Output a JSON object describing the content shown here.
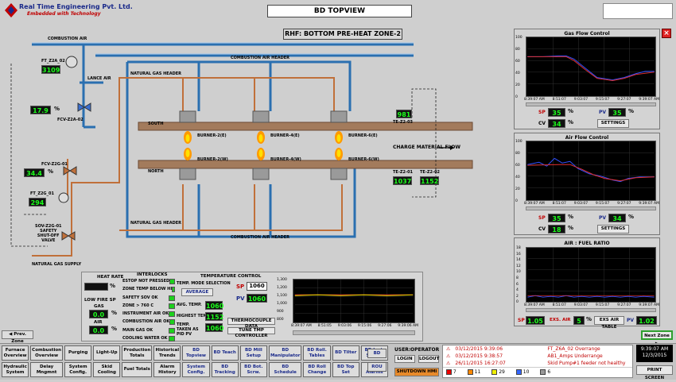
{
  "header": {
    "company_name": "Real Time Engineering Pvt. Ltd.",
    "company_tagline": "Embedded with Technology",
    "title": "BD TOPVIEW"
  },
  "schematic": {
    "zone_title": "RHF: BOTTOM PRE-HEAT ZONE-2",
    "labels": {
      "combustion_air": "COMBUSTION AIR",
      "combustion_air_header": "COMBUSTION AIR HEADER",
      "natural_gas_header": "NATURAL GAS HEADER",
      "lance_air": "LANCE AIR",
      "south": "SOUTH",
      "north": "NORTH",
      "burner_2e": "BURNER-2(E)",
      "burner_4e": "BURNER-4(E)",
      "burner_6e": "BURNER-6(E)",
      "burner_2w": "BURNER-2(W)",
      "burner_4w": "BURNER-4(W)",
      "burner_6w": "BURNER-6(W)",
      "charge_flow": "CHARGE MATERIAL  FLOW",
      "natural_gas_supply": "NATURAL GAS SUPPLY",
      "sov": "SOV-Z2G-01",
      "sov_safety": "SAFETY",
      "sov_shutoff": "SHUT-OFF",
      "sov_valve": "VALVE",
      "ft_z2a": "FT_Z2A_02",
      "fcv_z2a": "FCV-Z2A-02",
      "fcv_z2g": "FCV-Z2G-01",
      "ft_z2g": "FT_Z2G_01",
      "te_z2_03": "TE-Z2-03",
      "te_z2_01": "TE-Z2-01",
      "te_z2_02": "TE-Z2-02"
    },
    "values": {
      "ft_z2a": "3109",
      "fcv_z2a_pct": "17.9",
      "fcv_z2g_pct": "34.4",
      "ft_z2g": "294",
      "te_z2_03": "981",
      "te_z2_01": "1037",
      "te_z2_02": "1152"
    },
    "pct_sign": "%"
  },
  "gas_flow": {
    "title": "Gas Flow Control",
    "y_ticks": [
      "100",
      "80",
      "60",
      "40",
      "20",
      "0"
    ],
    "x_ticks": [
      "8:39:07 AM",
      "8:51:07",
      "9:03:07",
      "9:15:07",
      "9:27:07",
      "9:39:07 AM"
    ],
    "sp_label": "SP",
    "sp": "35",
    "pv_label": "PV",
    "pv": "35",
    "cv_label": "CV",
    "cv": "34",
    "unit": "%",
    "settings": "SETTINGS"
  },
  "air_flow": {
    "title": "Air Flow Control",
    "y_ticks": [
      "100",
      "80",
      "60",
      "40",
      "20",
      "0"
    ],
    "x_ticks": [
      "8:39:07 AM",
      "8:51:07",
      "9:03:07",
      "9:15:07",
      "9:27:07",
      "9:39:07 AM"
    ],
    "sp_label": "SP",
    "sp": "35",
    "pv_label": "PV",
    "pv": "34",
    "cv_label": "CV",
    "cv": "18",
    "unit": "%",
    "settings": "SETTINGS"
  },
  "ratio": {
    "title": "AIR : FUEL RATIO",
    "y_ticks": [
      "18",
      "16",
      "14",
      "12",
      "10",
      "8",
      "6",
      "4",
      "2",
      "0"
    ],
    "x_ticks": [
      "8:39:07 AM",
      "8:51:07",
      "9:03:07",
      "9:15:07",
      "9:27:07",
      "9:39:07 AM"
    ],
    "sp_label": "SP",
    "sp": "1.05",
    "exs_label": "EXS. AIR",
    "exs": "5",
    "unit": "%",
    "exs_table": "EXS AIR TABLE",
    "pv_label": "PV",
    "pv": "1.02"
  },
  "bottom_panel": {
    "heat_rate": "HEAT RATE",
    "low_fire_sp": "LOW FIRE SP",
    "gas": "GAS",
    "air": "AIR",
    "gas_val": "0.0",
    "air_val": "0.0",
    "pct": "%",
    "interlocks_title": "INTERLOCKS",
    "interlocks": [
      "ESTOP NOT PRESSED",
      "ZONE TEMP BELOW HI",
      "SAFETY SOV OK",
      "ZONE > 760 C",
      "INSTRUMENT AIR OK",
      "COMBUSTION AIR OK",
      "MAIN GAS OK",
      "COOLING WATER OK"
    ],
    "temp_control_title": "TEMPERATURE CONTROL",
    "mode_selection": "TEMP. MODE SELECTION",
    "average": "AVERAGE",
    "avg_temp_label": "AVG. TEMP.",
    "avg_temp": "1060",
    "highest_temp_label": "HIGHEST TEMP.",
    "highest_temp": "1152",
    "temp_taken_label": "TEMP. TAKEN AS PID PV",
    "temp_taken": "1060",
    "thermocouple_data": "THERMOCOUPLE DATA",
    "tune_tmp": "TUNE TMP CONTROLLER",
    "sp_label": "SP",
    "sp": "1060",
    "pv_label": "PV",
    "pv": "1060",
    "mini_y_ticks": [
      "1,300",
      "1,200",
      "1,100",
      "1,000",
      "900",
      "800"
    ],
    "mini_x_ticks": [
      "8:39:07 AM",
      "8:51:05",
      "9:03:06",
      "9:15:06",
      "9:27:06",
      "9:39:06 AM"
    ]
  },
  "nav": {
    "prev_zone": "Prev. Zone",
    "next_zone": "Next Zone",
    "row1": [
      "Furnace Overview",
      "Combustion Overview",
      "Purging",
      "Light-Up",
      "Production Totals",
      "Historical Trends",
      "BD Topview",
      "BD Teach",
      "BD Mill Setup",
      "BD Manipulator",
      "BD Roll. Tables",
      "BD Tilter",
      "BD Lmt. Swtch.",
      "BD"
    ],
    "row2": [
      "Hydraulic System",
      "Delay Mngmnt",
      "System Config.",
      "Skid Cooling",
      "Fuel Totals",
      "Alarm History",
      "System Config.",
      "BD Tracking",
      "BD Bot. Scrw.",
      "BD Schedule",
      "BD Roll Change",
      "BD Top Set",
      "BD Alarms",
      "ROU"
    ],
    "user_label": "USER:",
    "user_name": "OPERATOR",
    "login": "LOGIN",
    "logout": "LOGOUT",
    "shutdown": "SHUTDOWN HMI",
    "print_screen": "PRINT SCREEN",
    "clock_time": "9:39:07 AM",
    "clock_date": "12/3/2015"
  },
  "alarms": [
    {
      "date": "03/12/2015 9:39:06",
      "text": "FT_Z6A_02 Overrange"
    },
    {
      "date": "03/12/2015 9:38:57",
      "text": "AB1_Amps Underrange"
    },
    {
      "date": "26/11/2015 16:27:07",
      "text": "Skid Pump#1 feeder not healthy"
    }
  ],
  "alarm_counts": [
    "7",
    "11",
    "29",
    "10",
    "6"
  ]
}
